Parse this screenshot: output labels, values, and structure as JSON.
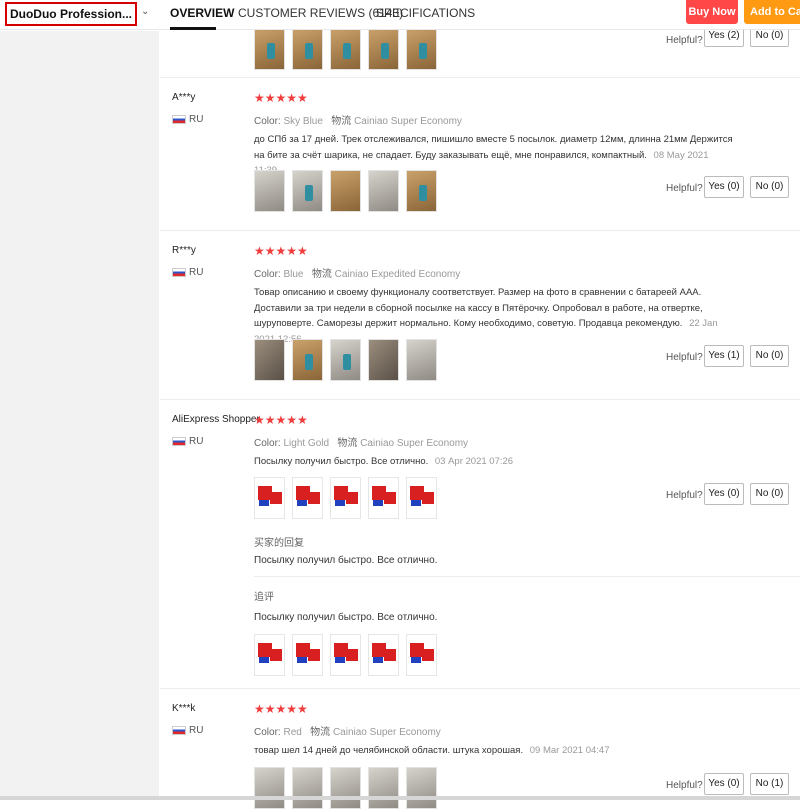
{
  "header": {
    "store_name": "DuoDuo Profession...",
    "tabs": [
      {
        "label": "OVERVIEW",
        "active": true
      },
      {
        "label": "CUSTOMER REVIEWS (6143)",
        "active": false
      },
      {
        "label": "SPECIFICATIONS",
        "active": false
      }
    ],
    "buy_now": "Buy Now",
    "add_to_cart": "Add to Cart",
    "colors": {
      "buy_now": "#ff4747",
      "add_to_cart": "#ff9a12"
    }
  },
  "helpful_label": "Helpful?",
  "star_color": "#f03d3d",
  "stars_text": "★★★★★",
  "reviews": [
    {
      "partial": true,
      "yes": "Yes (2)",
      "no": "No (0)",
      "photos": 5
    },
    {
      "author": "A***y",
      "country": "RU",
      "rating": 5,
      "color_label": "Color:",
      "color": "Sky Blue",
      "shipping_label": "物流",
      "shipping": "Cainiao Super Economy",
      "text": "до СПб за 17 дней. Трек отслеживался, пишишло вместе 5 посылок. диаметр 12мм, длинна 21мм Держится на бите за счёт шарика, не спадает. Буду заказывать ещё, мне понравился, компактный.",
      "date": "08 May 2021 11:39",
      "photos": 5,
      "yes": "Yes (0)",
      "no": "No (0)"
    },
    {
      "author": "R***y",
      "country": "RU",
      "rating": 5,
      "color_label": "Color:",
      "color": "Blue",
      "shipping_label": "物流",
      "shipping": "Cainiao Expedited Economy",
      "text": "Товар описанию и своему функционалу соответствует. Размер на фото в сравнении с батареей ААА. Доставили за три недели в сборной посылке на кассу в Пятёрочку. Опробовал в работе, на отвертке, шуруповерте. Саморезы держит нормально. Кому необходимо, советую. Продавца рекомендую.",
      "date": "22 Jan 2021 12:56",
      "photos": 5,
      "yes": "Yes (1)",
      "no": "No (0)"
    },
    {
      "author": "AliExpress Shopper",
      "country": "RU",
      "rating": 5,
      "color_label": "Color:",
      "color": "Light Gold",
      "shipping_label": "物流",
      "shipping": "Cainiao Super Economy",
      "text": "Посылку получил быстро. Все отлично.",
      "date": "03 Apr 2021 07:26",
      "photos": 5,
      "yes": "Yes (0)",
      "no": "No (0)",
      "reply_label": "买家的回复",
      "reply_text": "Посылку получил быстро. Все отлично.",
      "followup_label": "追评",
      "followup_text": "Посылку получил быстро. Все отлично."
    },
    {
      "author": "K***k",
      "country": "RU",
      "rating": 5,
      "color_label": "Color:",
      "color": "Red",
      "shipping_label": "物流",
      "shipping": "Cainiao Super Economy",
      "text": "товар шел 14 дней до челябинской области. штука хорошая.",
      "date": "09 Mar 2021 04:47",
      "photos": 5,
      "yes": "Yes (0)",
      "no": "No (1)"
    }
  ]
}
